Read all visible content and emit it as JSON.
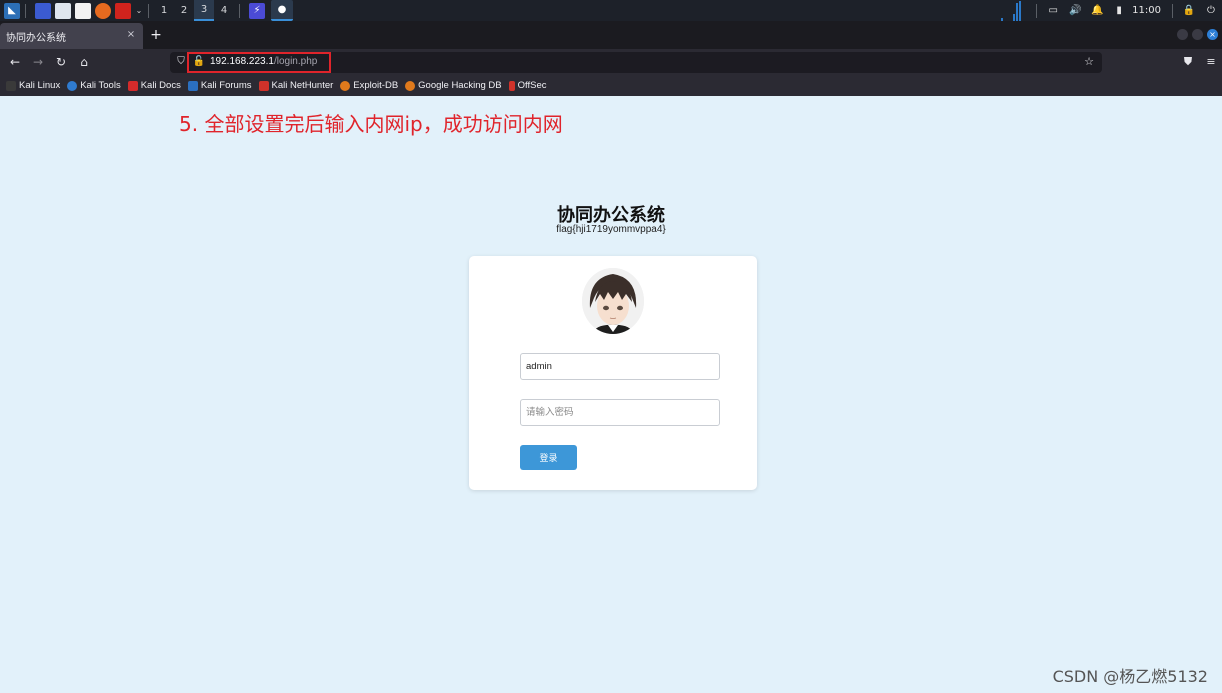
{
  "taskbar": {
    "workspaces": [
      "1",
      "2",
      "3",
      "4"
    ],
    "active_workspace": "3",
    "clock": "11:00"
  },
  "browser": {
    "tab_title": "协同办公系统",
    "tab_close": "×",
    "new_tab": "+",
    "url_host": "192.168.223.1",
    "url_path": "/login.php",
    "bookmarks": [
      "Kali Linux",
      "Kali Tools",
      "Kali Docs",
      "Kali Forums",
      "Kali NetHunter",
      "Exploit-DB",
      "Google Hacking DB",
      "OffSec"
    ]
  },
  "page": {
    "annotation": "5. 全部设置完后输入内网ip，成功访问内网",
    "title": "协同办公系统",
    "flag": "flag{hji1719yommvppa4}",
    "username_value": "admin",
    "password_placeholder": "请输入密码",
    "login_label": "登录",
    "watermark": "CSDN @杨乙燃5132"
  },
  "colors": {
    "annotation": "#e0242b",
    "login_button": "#3d97d8",
    "page_background": "#e2f1fa"
  },
  "icons": [
    "kali-menu-icon",
    "terminal-icon",
    "folder-icon",
    "text-editor-icon",
    "firefox-icon",
    "screen-tool-icon",
    "shield-icon",
    "lock-icon",
    "star-icon",
    "pocket-icon",
    "menu-icon"
  ]
}
